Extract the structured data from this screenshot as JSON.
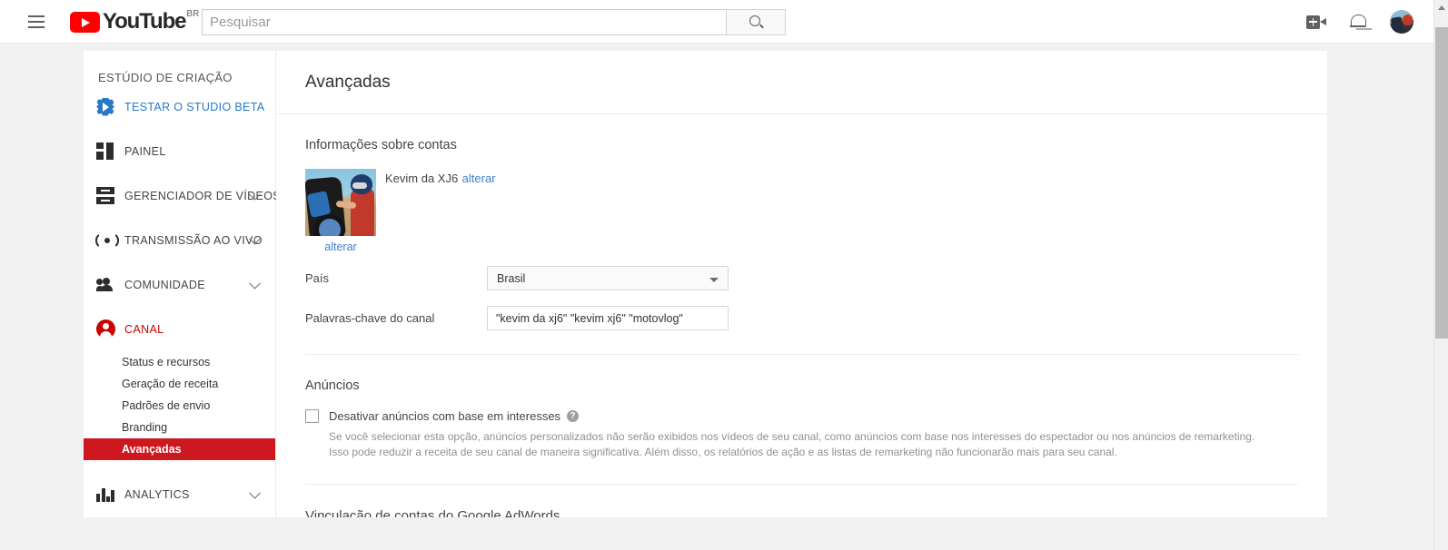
{
  "masthead": {
    "menu_icon": "hamburger-icon",
    "logo_text": "YouTube",
    "logo_country": "BR",
    "search": {
      "value": "",
      "placeholder": "Pesquisar",
      "button_icon": "search-icon"
    },
    "upload_icon": "video-camera-plus-icon",
    "notifications_icon": "bell-icon",
    "avatar_icon": "user-avatar"
  },
  "sidebar": {
    "title": "ESTÚDIO DE CRIAÇÃO",
    "items": [
      {
        "label": "TESTAR O STUDIO BETA",
        "icon": "gear-play-icon",
        "style": "blue",
        "expandable": false
      },
      {
        "label": "PAINEL",
        "icon": "dashboard-icon",
        "style": "normal",
        "expandable": false
      },
      {
        "label": "GERENCIADOR DE VÍDEOS",
        "icon": "video-stack-icon",
        "style": "normal",
        "expandable": true
      },
      {
        "label": "TRANSMISSÃO AO VIVO",
        "icon": "live-broadcast-icon",
        "style": "normal",
        "expandable": true
      },
      {
        "label": "COMUNIDADE",
        "icon": "people-icon",
        "style": "normal",
        "expandable": true
      },
      {
        "label": "CANAL",
        "icon": "person-circle-icon",
        "style": "red",
        "expandable": false
      }
    ],
    "channel_subitems": [
      {
        "label": "Status e recursos",
        "active": false
      },
      {
        "label": "Geração de receita",
        "active": false
      },
      {
        "label": "Padrões de envio",
        "active": false
      },
      {
        "label": "Branding",
        "active": false
      },
      {
        "label": "Avançadas",
        "active": true
      }
    ],
    "analytics": {
      "label": "ANALYTICS",
      "icon": "bar-chart-icon",
      "expandable": true
    }
  },
  "page": {
    "title": "Avançadas",
    "account_section": {
      "title": "Informações sobre contas",
      "channel_name": "Kevim da XJ6",
      "change_link": "alterar",
      "thumbnail_change_link": "alterar",
      "country_label": "País",
      "country_value": "Brasil",
      "keywords_label": "Palavras-chave do canal",
      "keywords_value": "\"kevim da xj6\" \"kevim xj6\" \"motovlog\""
    },
    "ads_section": {
      "title": "Anúncios",
      "checkbox_label": "Desativar anúncios com base em interesses",
      "checkbox_checked": false,
      "help_icon": "question-mark-icon",
      "description_line1": "Se você selecionar esta opção, anúncios personalizados não serão exibidos nos vídeos de seu canal, como anúncios com base nos interesses do espectador ou nos anúncios de remarketing.",
      "description_line2": "Isso pode reduzir a receita de seu canal de maneira significativa. Além disso, os relatórios de ação e as listas de remarketing não funcionarão mais para seu canal."
    },
    "adwords_section": {
      "title": "Vinculação de contas do Google AdWords"
    }
  },
  "colors": {
    "brand_red": "#cc181e",
    "link_blue": "#3c7fd0",
    "active_red": "#cc0000"
  }
}
